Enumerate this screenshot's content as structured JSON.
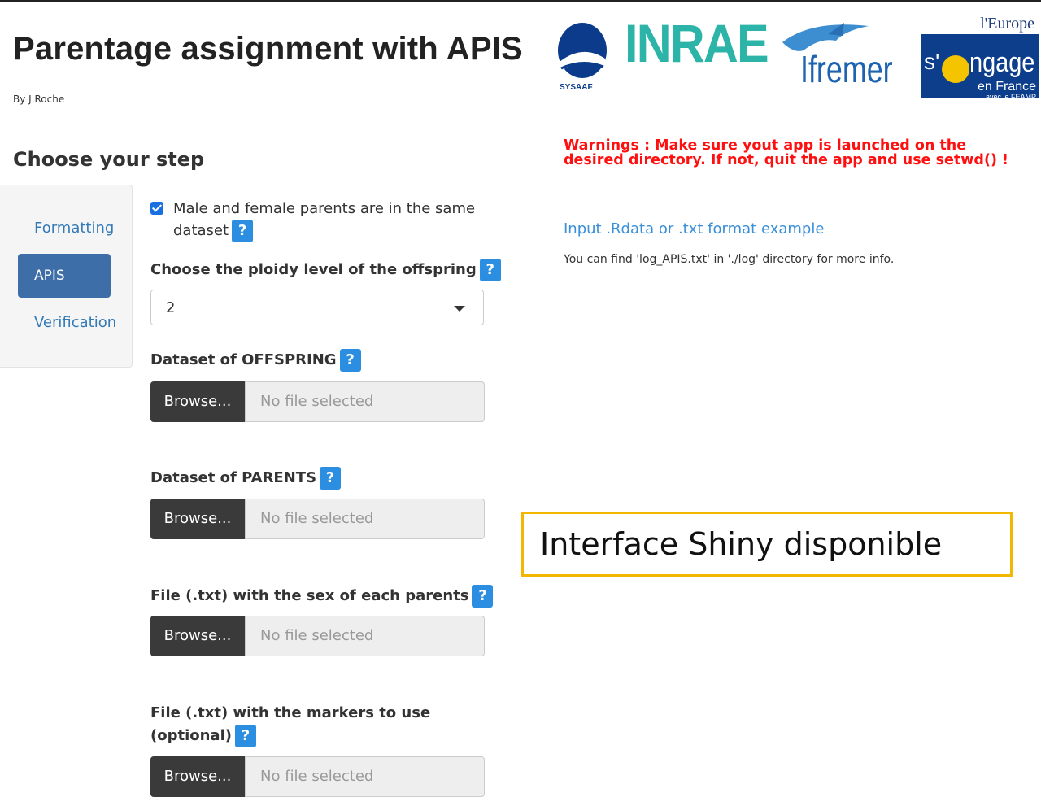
{
  "header": {
    "title": "Parentage assignment with APIS",
    "author": "By J.Roche",
    "logos": {
      "sysaaf": "SYSAAF",
      "inrae": "INRAE",
      "ifremer": "Ifremer",
      "europe_top": "l'Europe",
      "europe_s": "s'",
      "europe_engage": "ngage",
      "europe_fr": "en France",
      "europe_feamp": "avec le FEAMP"
    }
  },
  "step_heading": "Choose your step",
  "sidebar": {
    "items": [
      {
        "label": "Formatting",
        "active": false
      },
      {
        "label": "APIS",
        "active": true
      },
      {
        "label": "Verification",
        "active": false
      }
    ]
  },
  "form": {
    "same_dataset_checkbox": {
      "label": "Male and female parents are in the same dataset",
      "checked": true
    },
    "help_glyph": "?",
    "ploidy": {
      "label": "Choose the ploidy level of the offspring",
      "value": "2"
    },
    "files": [
      {
        "label": "Dataset of OFFSPRING",
        "button": "Browse...",
        "placeholder": "No file selected"
      },
      {
        "label": "Dataset of PARENTS",
        "button": "Browse...",
        "placeholder": "No file selected"
      },
      {
        "label": "File (.txt) with the sex of each parents",
        "button": "Browse...",
        "placeholder": "No file selected"
      },
      {
        "label_line1": "File (.txt) with the markers to use",
        "label_line2": "(optional)",
        "button": "Browse...",
        "placeholder": "No file selected"
      }
    ]
  },
  "right": {
    "warning": "Warnings : Make sure yout app is launched on the desired directory. If not, quit the app and use setwd() !",
    "example_link": "Input .Rdata or .txt format example",
    "log_info": "You can find 'log_APIS.txt' in './log' directory for more info.",
    "banner": "Interface Shiny disponible"
  },
  "colors": {
    "accent": "#3e6ea8",
    "link": "#337ab7",
    "help": "#2b8ee0",
    "warning": "#ff1010",
    "banner_border": "#f2b700"
  }
}
